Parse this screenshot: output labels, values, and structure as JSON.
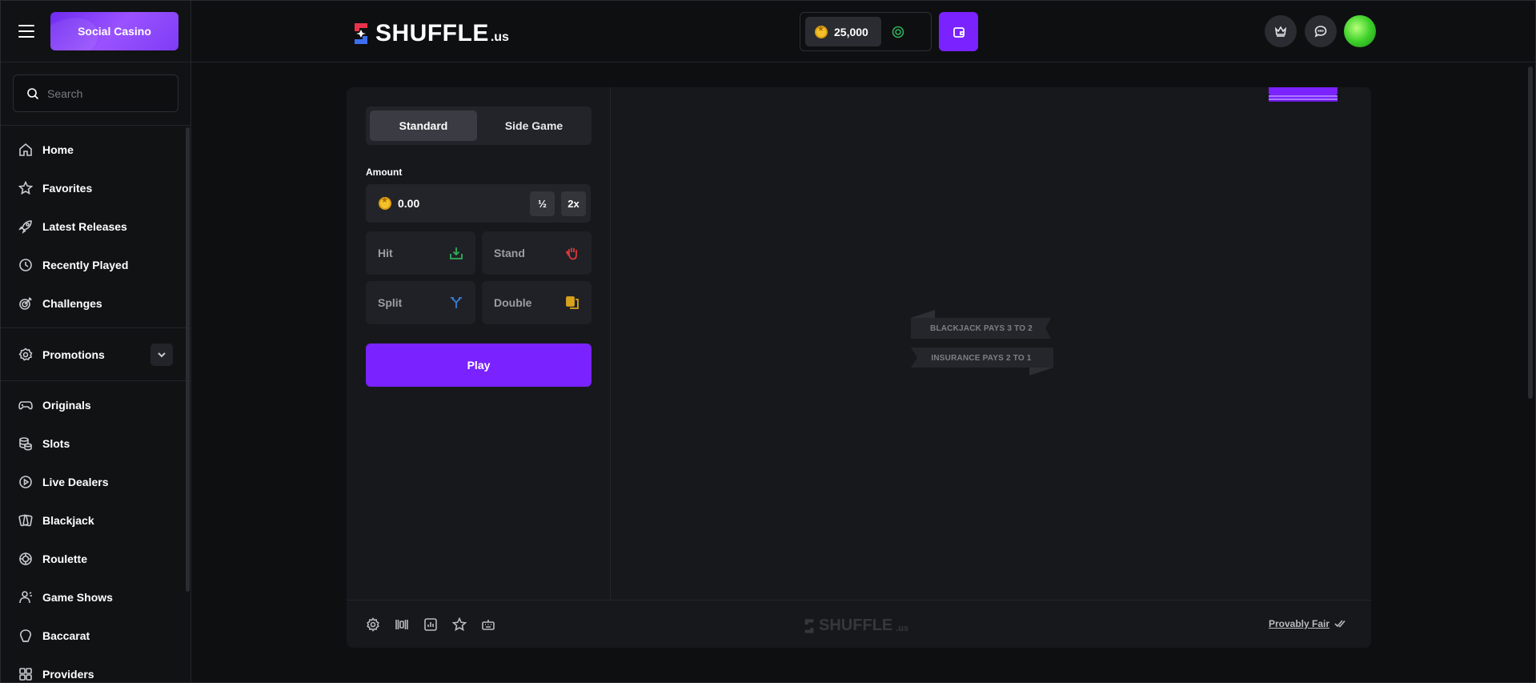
{
  "sidebar": {
    "social_casino_label": "Social Casino",
    "search_placeholder": "Search",
    "items_primary": [
      {
        "label": "Home",
        "icon": "home-icon"
      },
      {
        "label": "Favorites",
        "icon": "star-icon"
      },
      {
        "label": "Latest Releases",
        "icon": "rocket-icon"
      },
      {
        "label": "Recently Played",
        "icon": "clock-icon"
      },
      {
        "label": "Challenges",
        "icon": "target-icon"
      }
    ],
    "promotions_label": "Promotions",
    "items_games": [
      {
        "label": "Originals",
        "icon": "gamepad-icon"
      },
      {
        "label": "Slots",
        "icon": "coins-icon"
      },
      {
        "label": "Live Dealers",
        "icon": "play-circle-icon"
      },
      {
        "label": "Blackjack",
        "icon": "cards-icon"
      },
      {
        "label": "Roulette",
        "icon": "roulette-icon"
      },
      {
        "label": "Game Shows",
        "icon": "presenter-icon"
      },
      {
        "label": "Baccarat",
        "icon": "baccarat-icon"
      },
      {
        "label": "Providers",
        "icon": "providers-icon"
      }
    ]
  },
  "header": {
    "logo_text": "SHUFFLE",
    "logo_suffix": ".us",
    "balance": "25,000",
    "colors": {
      "accent": "#7a22ff",
      "coin": "#f3c12b"
    }
  },
  "game": {
    "tabs": [
      "Standard",
      "Side Game"
    ],
    "active_tab": "Standard",
    "amount_label": "Amount",
    "amount_value": "0.00",
    "half_label": "½",
    "double_label": "2x",
    "actions": [
      {
        "label": "Hit",
        "icon": "hit-icon",
        "color": "#2fae5a"
      },
      {
        "label": "Stand",
        "icon": "hand-icon",
        "color": "#e0363b"
      },
      {
        "label": "Split",
        "icon": "split-icon",
        "color": "#3a7bd5"
      },
      {
        "label": "Double",
        "icon": "double-icon",
        "color": "#d9a21c"
      }
    ],
    "play_label": "Play",
    "banner_blackjack": "BLACKJACK PAYS 3 TO 2",
    "banner_insurance": "INSURANCE PAYS 2 TO 1",
    "footer": {
      "logo_text": "SHUFFLE",
      "logo_suffix": ".us",
      "provably_fair": "Provably Fair"
    }
  }
}
